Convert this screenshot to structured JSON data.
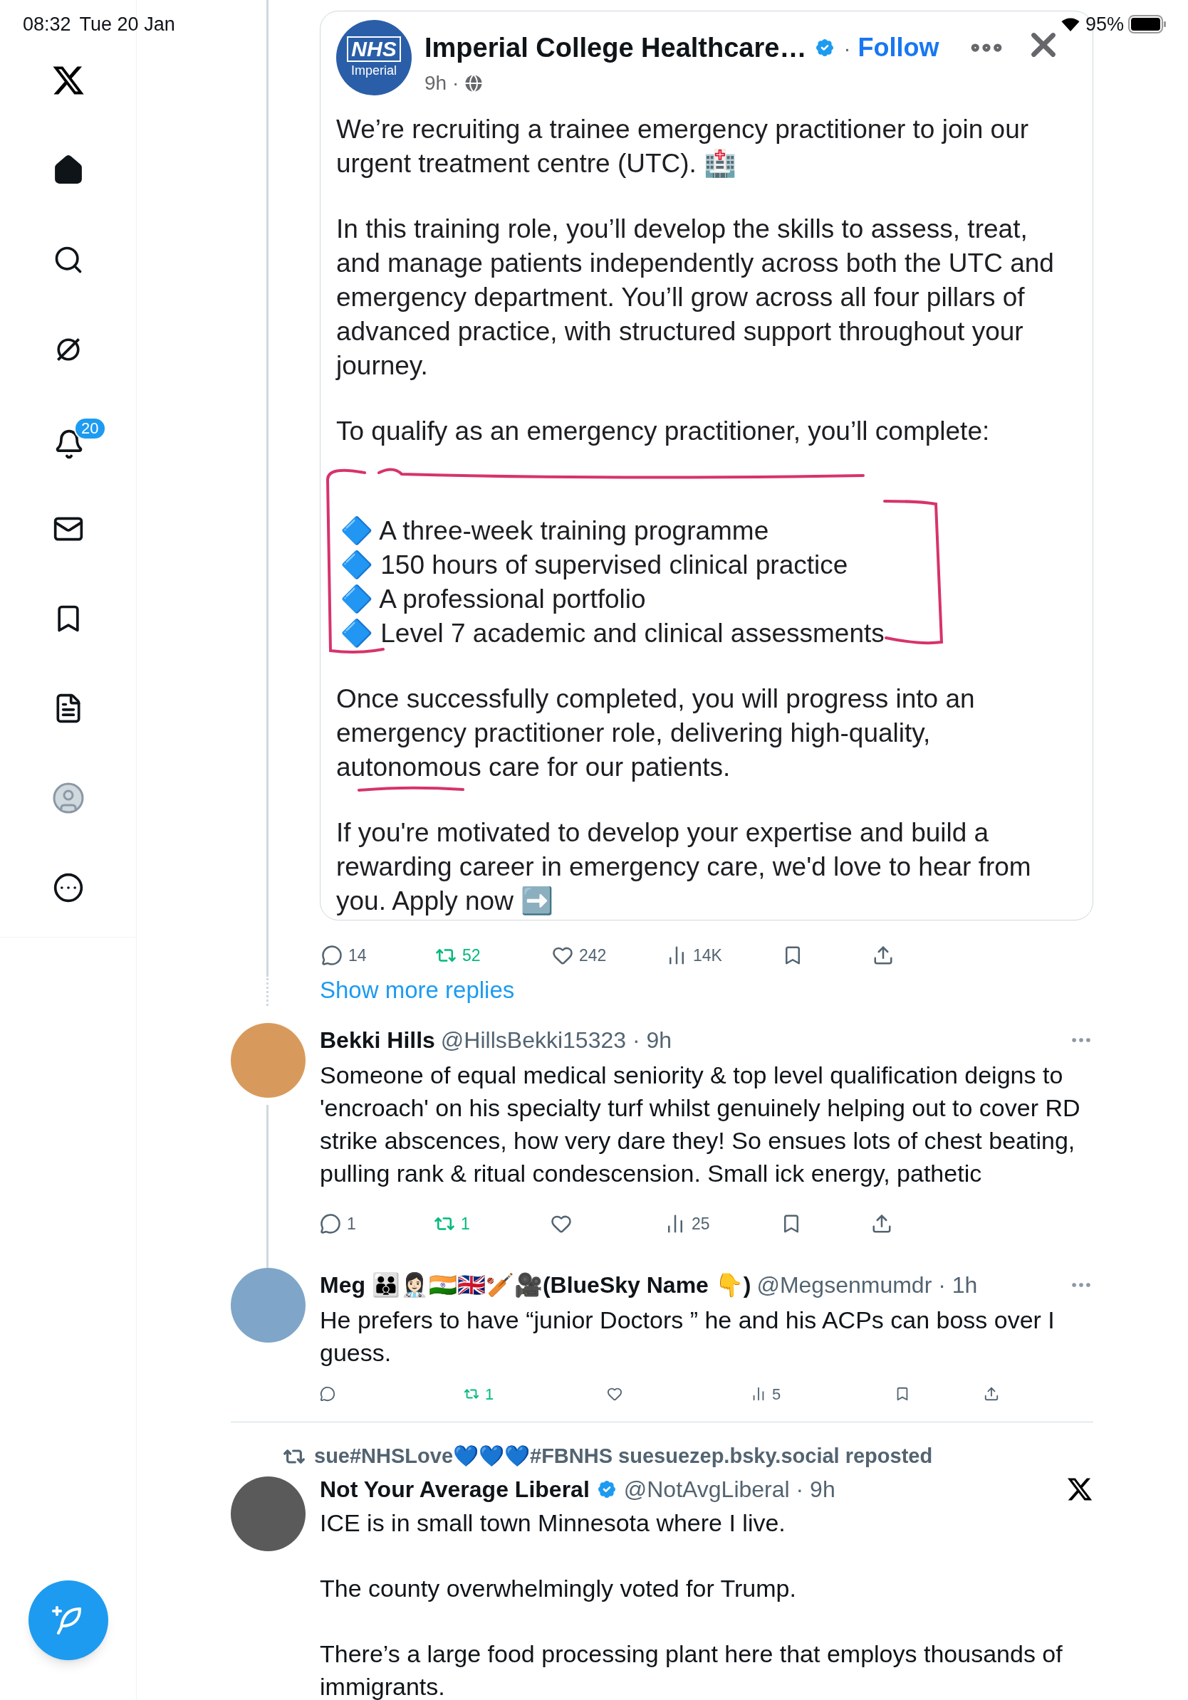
{
  "status_bar": {
    "time": "08:32",
    "date": "Tue 20 Jan",
    "battery": "95%"
  },
  "sidebar": {
    "items": [
      {
        "kind": "logo",
        "selected": false
      },
      {
        "kind": "home",
        "selected": true
      },
      {
        "kind": "search",
        "selected": false
      },
      {
        "kind": "grok",
        "selected": false
      },
      {
        "kind": "notifications",
        "selected": false,
        "badge": "20"
      },
      {
        "kind": "messages",
        "selected": false
      },
      {
        "kind": "bookmarks",
        "selected": false
      },
      {
        "kind": "lists",
        "selected": false
      },
      {
        "kind": "profile",
        "selected": false
      },
      {
        "kind": "more",
        "selected": false
      }
    ]
  },
  "post": {
    "card": {
      "logo_line1": "NHS",
      "logo_line2": "Imperial",
      "name": "Imperial College Healthcare…",
      "verified": true,
      "separator": "·",
      "follow": "Follow",
      "time": "9h ·",
      "blocks": [
        {
          "kind": "paragraph",
          "text": "We’re recruiting a trainee emergency practitioner to join our urgent treatment centre (UTC). 🏥"
        },
        {
          "kind": "paragraph",
          "text": "In this training role, you’ll develop the skills to assess, treat, and manage patients independently across both the UTC and emergency department. You’ll grow across all four pillars of advanced practice, with structured support throughout your journey."
        },
        {
          "kind": "paragraph",
          "text": "To qualify as an emergency practitioner, you’ll complete:"
        },
        {
          "kind": "list",
          "items": [
            "🔷 A three-week training programme",
            "🔷 150 hours of supervised clinical practice",
            "🔷 A professional portfolio",
            "🔷 Level 7 academic and clinical assessments"
          ]
        },
        {
          "kind": "paragraph",
          "text": "Once successfully completed, you will progress into an emergency practitioner role, delivering high-quality, autonomous care for our patients."
        },
        {
          "kind": "paragraph",
          "text": "If you're motivated to develop your expertise and build a rewarding career in emergency care, we'd love to hear from you. Apply now ➡️"
        }
      ]
    },
    "actions": [
      {
        "kind": "reply",
        "count": "14",
        "active": false
      },
      {
        "kind": "repost",
        "count": "52",
        "active": true
      },
      {
        "kind": "like",
        "count": "242",
        "active": false
      },
      {
        "kind": "views",
        "count": "14K",
        "active": false
      },
      {
        "kind": "bookmark",
        "active": false
      },
      {
        "kind": "share",
        "active": false
      }
    ]
  },
  "show_more": "Show more replies",
  "replies": [
    {
      "name": "Bekki Hills",
      "meta": "@HillsBekki15323 · 9h",
      "text": "Someone of equal medical seniority & top level qualification deigns to 'encroach' on his specialty turf whilst genuinely helping out to cover RD strike abscences, how very dare they! So ensues lots of chest beating, pulling rank & ritual condescension. Small ick energy, pathetic",
      "compact": false,
      "actions": [
        {
          "kind": "reply",
          "count": "1",
          "active": false
        },
        {
          "kind": "repost",
          "count": "1",
          "active": true
        },
        {
          "kind": "like",
          "active": false
        },
        {
          "kind": "views",
          "count": "25",
          "active": false
        },
        {
          "kind": "bookmark",
          "active": false
        },
        {
          "kind": "share",
          "active": false
        }
      ]
    },
    {
      "name": "Meg 👪👩🏻‍⚕️🇮🇳🇬🇧🏏🎥(BlueSky Name 👇)",
      "meta": "@Megsenmumdr · 1h",
      "text": "He prefers to have “junior Doctors ” he and his ACPs can boss over I guess.",
      "compact": true,
      "actions": [
        {
          "kind": "reply",
          "active": false
        },
        {
          "kind": "repost",
          "count": "1",
          "active": true
        },
        {
          "kind": "like",
          "active": false
        },
        {
          "kind": "views",
          "count": "5",
          "active": false
        },
        {
          "kind": "bookmark",
          "active": false
        },
        {
          "kind": "share",
          "active": false
        }
      ]
    }
  ],
  "repost": {
    "reposted_by": "sue#NHSLove💙💙💙#FBNHS suesuezep.bsky.social reposted",
    "name": "Not Your Average Liberal",
    "verified": true,
    "meta": "@NotAvgLiberal · 9h",
    "paragraphs": [
      "ICE is in small town Minnesota where I live.",
      "The county overwhelmingly voted for Trump.",
      "There’s a large food processing plant here that employs thousands of immigrants."
    ]
  }
}
